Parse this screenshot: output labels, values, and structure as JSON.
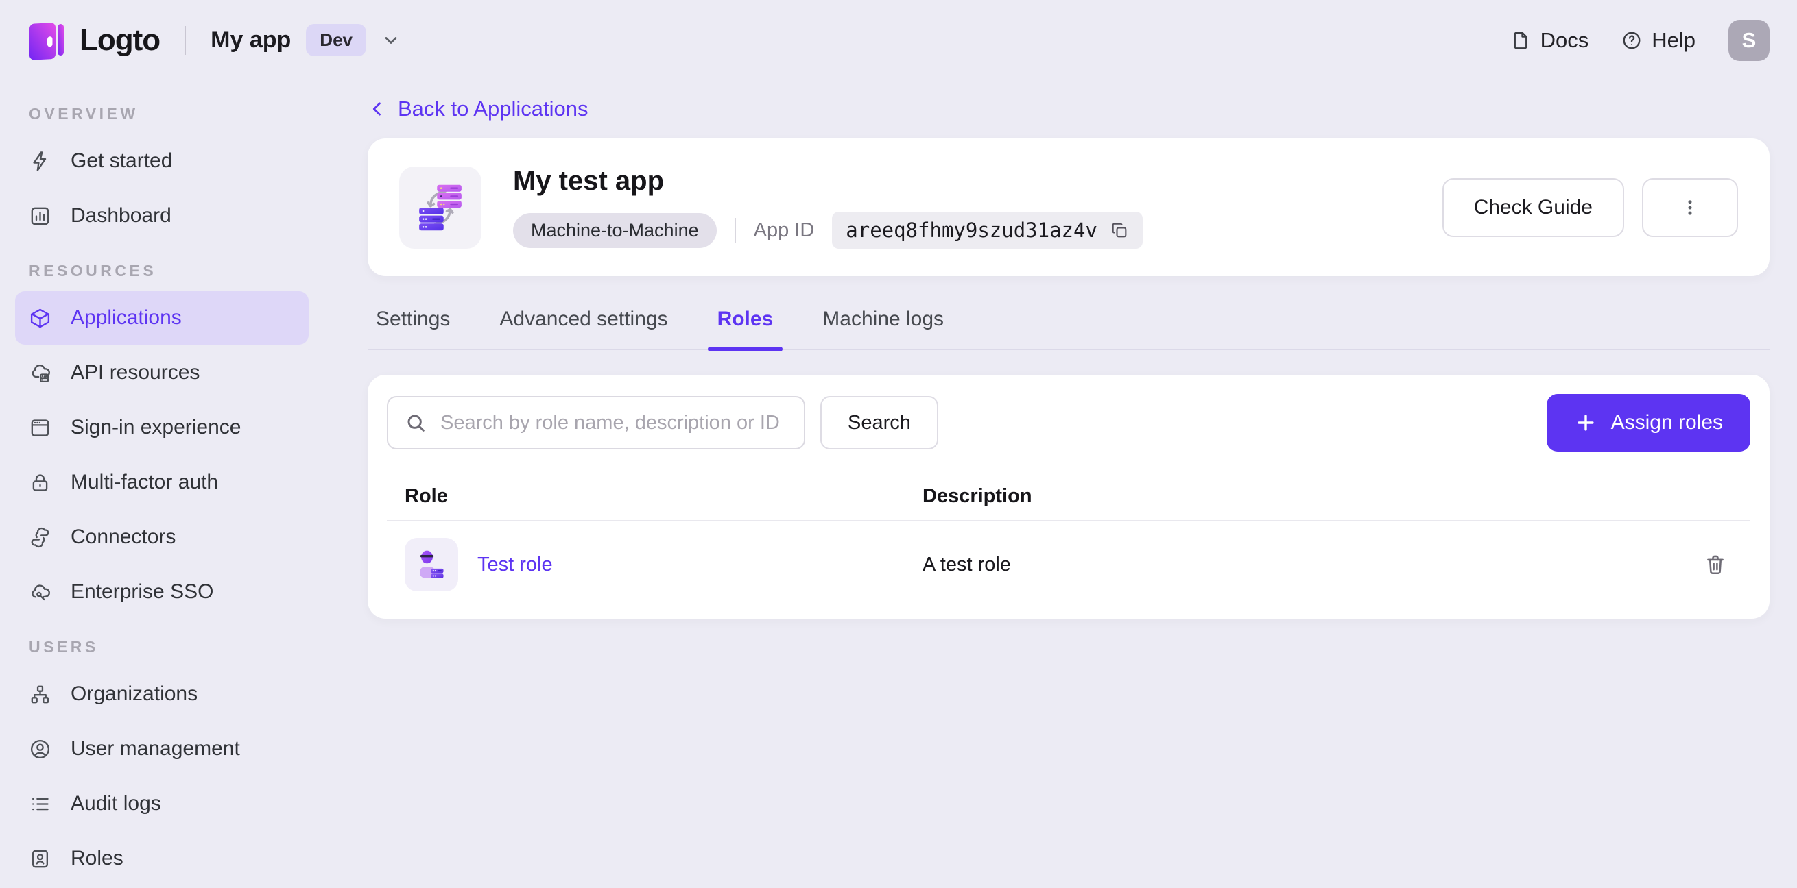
{
  "topbar": {
    "brand": "Logto",
    "app_name": "My app",
    "env_badge": "Dev",
    "docs_label": "Docs",
    "help_label": "Help",
    "avatar_initial": "S"
  },
  "sidebar": {
    "sections": [
      {
        "label": "OVERVIEW",
        "items": [
          {
            "label": "Get started",
            "icon": "lightning-icon"
          },
          {
            "label": "Dashboard",
            "icon": "bar-chart-icon"
          }
        ]
      },
      {
        "label": "RESOURCES",
        "items": [
          {
            "label": "Applications",
            "icon": "cube-icon",
            "active": true
          },
          {
            "label": "API resources",
            "icon": "cloud-database-icon"
          },
          {
            "label": "Sign-in experience",
            "icon": "browser-icon"
          },
          {
            "label": "Multi-factor auth",
            "icon": "lock-icon"
          },
          {
            "label": "Connectors",
            "icon": "connectors-icon"
          },
          {
            "label": "Enterprise SSO",
            "icon": "cloud-key-icon"
          }
        ]
      },
      {
        "label": "USERS",
        "items": [
          {
            "label": "Organizations",
            "icon": "org-chart-icon"
          },
          {
            "label": "User management",
            "icon": "user-circle-icon"
          },
          {
            "label": "Audit logs",
            "icon": "list-icon"
          },
          {
            "label": "Roles",
            "icon": "id-card-icon"
          }
        ]
      }
    ]
  },
  "main": {
    "back_link": "Back to Applications",
    "app": {
      "title": "My test app",
      "type_badge": "Machine-to-Machine",
      "app_id_label": "App ID",
      "app_id": "areeq8fhmy9szud31az4v"
    },
    "check_guide_label": "Check Guide",
    "tabs": [
      {
        "label": "Settings"
      },
      {
        "label": "Advanced settings"
      },
      {
        "label": "Roles",
        "active": true
      },
      {
        "label": "Machine logs"
      }
    ],
    "roles_panel": {
      "search_placeholder": "Search by role name, description or ID",
      "search_button_label": "Search",
      "assign_button_label": "Assign roles",
      "columns": {
        "role": "Role",
        "description": "Description"
      },
      "rows": [
        {
          "role_name": "Test role",
          "description": "A test role"
        }
      ]
    }
  },
  "colors": {
    "primary": "#5D34F2",
    "page_bg": "#ECEBF4",
    "card_bg": "#FFFFFF",
    "sidebar_active_bg": "#DED7F8",
    "badge_bg": "#DCD7F6",
    "pill_bg": "#EDECF1"
  }
}
